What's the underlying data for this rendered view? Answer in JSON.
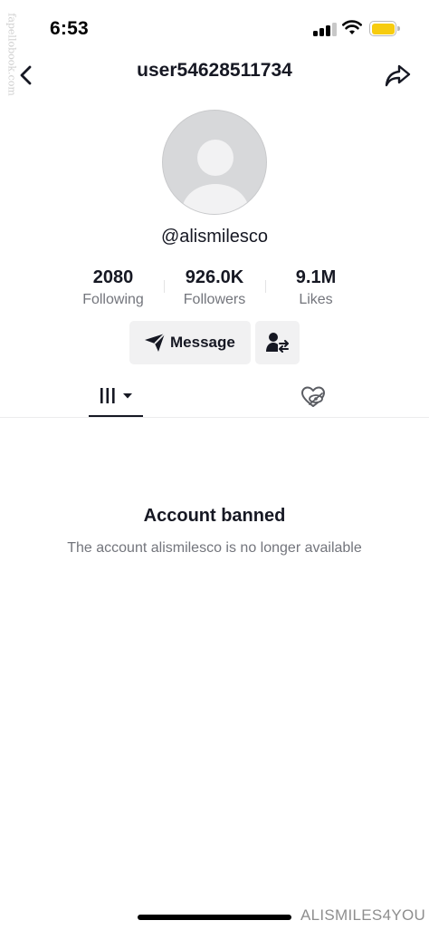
{
  "status_bar": {
    "time": "6:53"
  },
  "side_watermark": "fapellobook.com",
  "nav": {
    "title": "user54628511734",
    "back_icon": "chevron-left-icon",
    "share_icon": "share-arrow-icon"
  },
  "profile": {
    "handle": "@alismilesco",
    "stats": [
      {
        "value": "2080",
        "label": "Following"
      },
      {
        "value": "926.0K",
        "label": "Followers"
      },
      {
        "value": "9.1M",
        "label": "Likes"
      }
    ],
    "message_button": "Message"
  },
  "tabs": [
    {
      "icon": "videos-grid-icon",
      "active": true
    },
    {
      "icon": "liked-hidden-icon",
      "active": false
    }
  ],
  "empty_state": {
    "title": "Account banned",
    "description": "The account alismilesco is no longer available"
  },
  "bottom_watermark": "ALISMILES4YOU",
  "colors": {
    "battery": "#f7cc0f",
    "text": "#161823",
    "muted": "#73757c",
    "button_bg": "#f1f1f2"
  }
}
